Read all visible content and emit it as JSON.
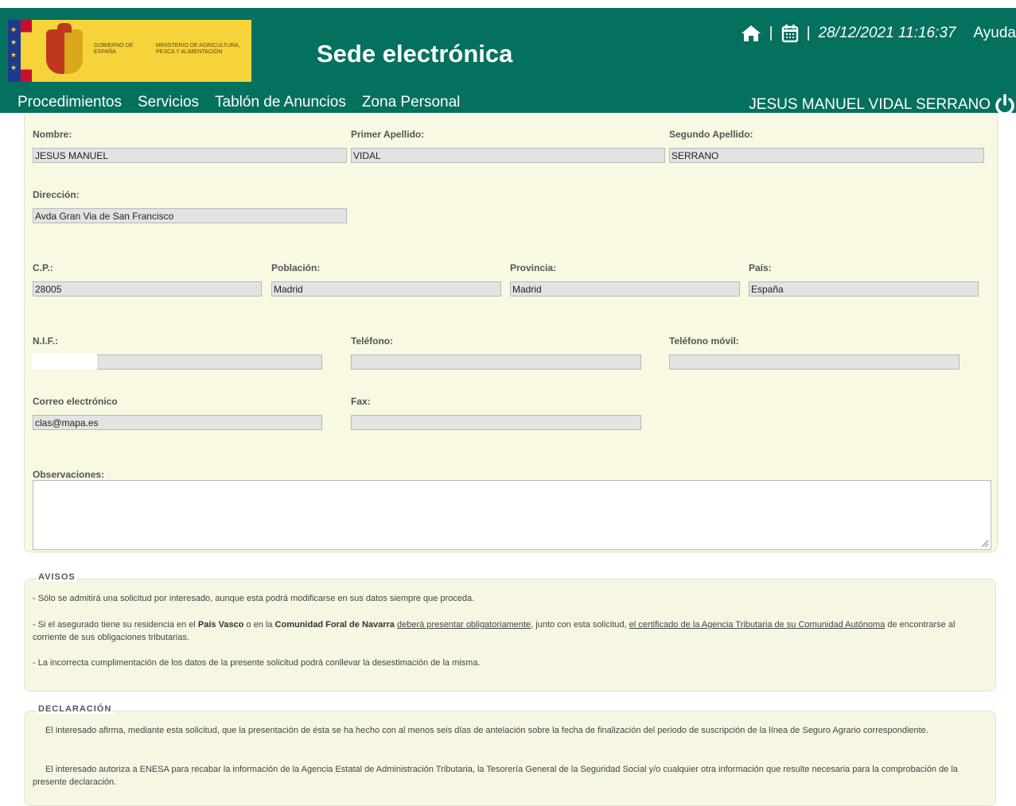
{
  "header": {
    "logo_gobierno": "GOBIERNO DE ESPAÑA",
    "logo_ministerio": "MINISTERIO DE AGRICULTURA, PESCA Y ALIMENTACIÓN",
    "site_title": "Sede electrónica",
    "separator": "|",
    "datetime": "28/12/2021 11:16:37",
    "help": "Ayuda",
    "user": "JESUS MANUEL VIDAL SERRANO"
  },
  "nav": {
    "items": [
      "Procedimientos",
      "Servicios",
      "Tablón de Anuncios",
      "Zona Personal"
    ]
  },
  "form": {
    "nombre_label": "Nombre:",
    "nombre": "JESUS MANUEL",
    "primer_apellido_label": "Primer Apellido:",
    "primer_apellido": "VIDAL",
    "segundo_apellido_label": "Segundo Apellido:",
    "segundo_apellido": "SERRANO",
    "direccion_label": "Dirección:",
    "direccion": "Avda Gran Via de San Francisco",
    "cp_label": "C.P.:",
    "cp": "28005",
    "poblacion_label": "Población:",
    "poblacion": "Madrid",
    "provincia_label": "Provincia:",
    "provincia": "Madrid",
    "pais_label": "País:",
    "pais": "España",
    "nif_label": "N.I.F.:",
    "nif": "",
    "telefono_label": "Teléfono:",
    "telefono": "",
    "movil_label": "Teléfono móvil:",
    "movil": "",
    "correo_label": "Correo electrónico",
    "correo": "clas@mapa.es",
    "fax_label": "Fax:",
    "fax": "",
    "observaciones_label": "Observaciones:",
    "observaciones": ""
  },
  "avisos": {
    "title": "AVISOS",
    "p1": "- Sólo se admitirá una solicitud por interesado, aunque esta podrá modificarse en sus datos siempre que proceda.",
    "p2_a": "- Si el asegurado tiene su residencia en el ",
    "p2_b": "País Vasco",
    "p2_c": " o en la ",
    "p2_d": "Comunidad Foral de Navarra",
    "p2_e": " ",
    "p2_f": "deberá presentar obligatoriamente",
    "p2_g": ", junto con esta solicitud, ",
    "p2_h": "el certificado de la Agencia Tributaria de su Comunidad Autónoma",
    "p2_i": " de encontrarse al corriente de sus obligaciones tributarias.",
    "p3": "- La incorrecta cumplimentación de los datos de la presente solicitud podrá conllevar la desestimación de la misma."
  },
  "declaracion": {
    "title": "DECLARACIÓN",
    "p1": "El interesado afirma, mediante esta solicitud, que la presentación de ésta se ha hecho con al menos seis días de antelación sobre la fecha de finalización del periodo de suscripción de la línea de Seguro Agrario correspondiente.",
    "p2": "El interesado autoriza a ENESA para recabar la información de la Agencia Estatal de Administración Tributaria, la Tesorería General de la Seguridad Social y/o cualquier otra información que resulte necesaria para la comprobación de la presente declaración."
  },
  "colors": {
    "header_bg": "#04705e",
    "logo_bg": "#f6d33a",
    "panel_bg": "#f8f8e3",
    "input_bg": "#e3e3e3"
  },
  "icons": [
    "home-icon",
    "calendar-icon",
    "power-icon",
    "resize-grip-icon"
  ]
}
